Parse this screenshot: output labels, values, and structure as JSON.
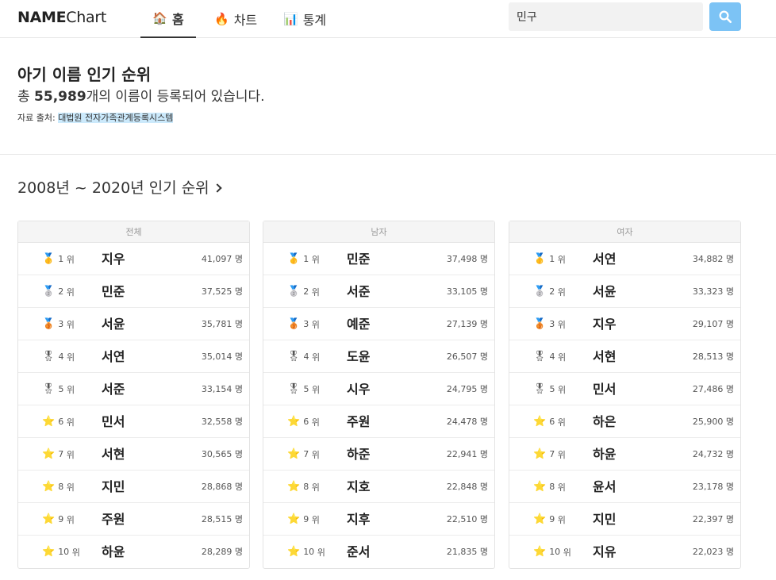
{
  "nav": {
    "logo_bold": "NAME",
    "logo_thin": "Chart",
    "tabs": [
      {
        "icon": "🏠",
        "label": "홈"
      },
      {
        "icon": "🔥",
        "label": "차트"
      },
      {
        "icon": "📊",
        "label": "통계"
      }
    ],
    "search_value": "민구"
  },
  "hero": {
    "title": "아기 이름 인기 순위",
    "sub_prefix": "총 ",
    "total": "55,989",
    "sub_suffix": "개의 이름이 등록되어 있습니다.",
    "source_label": "자료 출처: ",
    "source_link": "대법원 전자가족관계등록시스템"
  },
  "section": {
    "title": "2008년 ~ 2020년 인기 순위"
  },
  "rank_suffix": "위",
  "count_suffix": "명",
  "tables": [
    {
      "header": "전체",
      "rows": [
        {
          "medal": "🥇",
          "rank": "1",
          "name": "지우",
          "count": "41,097"
        },
        {
          "medal": "🥈",
          "rank": "2",
          "name": "민준",
          "count": "37,525"
        },
        {
          "medal": "🥉",
          "rank": "3",
          "name": "서윤",
          "count": "35,781"
        },
        {
          "medal": "🎖",
          "rank": "4",
          "name": "서연",
          "count": "35,014"
        },
        {
          "medal": "🎖",
          "rank": "5",
          "name": "서준",
          "count": "33,154"
        },
        {
          "medal": "⭐",
          "rank": "6",
          "name": "민서",
          "count": "32,558"
        },
        {
          "medal": "⭐",
          "rank": "7",
          "name": "서현",
          "count": "30,565"
        },
        {
          "medal": "⭐",
          "rank": "8",
          "name": "지민",
          "count": "28,868"
        },
        {
          "medal": "⭐",
          "rank": "9",
          "name": "주원",
          "count": "28,515"
        },
        {
          "medal": "⭐",
          "rank": "10",
          "name": "하윤",
          "count": "28,289"
        }
      ]
    },
    {
      "header": "남자",
      "rows": [
        {
          "medal": "🥇",
          "rank": "1",
          "name": "민준",
          "count": "37,498"
        },
        {
          "medal": "🥈",
          "rank": "2",
          "name": "서준",
          "count": "33,105"
        },
        {
          "medal": "🥉",
          "rank": "3",
          "name": "예준",
          "count": "27,139"
        },
        {
          "medal": "🎖",
          "rank": "4",
          "name": "도윤",
          "count": "26,507"
        },
        {
          "medal": "🎖",
          "rank": "5",
          "name": "시우",
          "count": "24,795"
        },
        {
          "medal": "⭐",
          "rank": "6",
          "name": "주원",
          "count": "24,478"
        },
        {
          "medal": "⭐",
          "rank": "7",
          "name": "하준",
          "count": "22,941"
        },
        {
          "medal": "⭐",
          "rank": "8",
          "name": "지호",
          "count": "22,848"
        },
        {
          "medal": "⭐",
          "rank": "9",
          "name": "지후",
          "count": "22,510"
        },
        {
          "medal": "⭐",
          "rank": "10",
          "name": "준서",
          "count": "21,835"
        }
      ]
    },
    {
      "header": "여자",
      "rows": [
        {
          "medal": "🥇",
          "rank": "1",
          "name": "서연",
          "count": "34,882"
        },
        {
          "medal": "🥈",
          "rank": "2",
          "name": "서윤",
          "count": "33,323"
        },
        {
          "medal": "🥉",
          "rank": "3",
          "name": "지우",
          "count": "29,107"
        },
        {
          "medal": "🎖",
          "rank": "4",
          "name": "서현",
          "count": "28,513"
        },
        {
          "medal": "🎖",
          "rank": "5",
          "name": "민서",
          "count": "27,486"
        },
        {
          "medal": "⭐",
          "rank": "6",
          "name": "하은",
          "count": "25,900"
        },
        {
          "medal": "⭐",
          "rank": "7",
          "name": "하윤",
          "count": "24,732"
        },
        {
          "medal": "⭐",
          "rank": "8",
          "name": "윤서",
          "count": "23,178"
        },
        {
          "medal": "⭐",
          "rank": "9",
          "name": "지민",
          "count": "22,397"
        },
        {
          "medal": "⭐",
          "rank": "10",
          "name": "지유",
          "count": "22,023"
        }
      ]
    }
  ]
}
